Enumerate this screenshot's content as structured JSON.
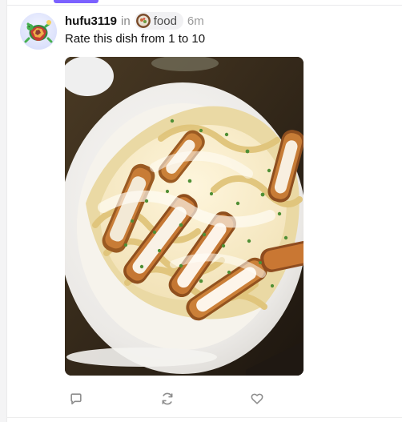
{
  "post": {
    "username": "hufu3119",
    "in_label": "in",
    "community": "food",
    "timestamp": "6m",
    "text": "Rate this dish from 1 to 10"
  },
  "icons": {
    "avatar": "turtle-avatar-icon",
    "community": "food-community-icon",
    "comment": "comment-icon",
    "repost": "repost-icon",
    "like": "heart-icon"
  },
  "colors": {
    "accent": "#7b61ff",
    "text_primary": "#111111",
    "text_muted": "#888888"
  }
}
